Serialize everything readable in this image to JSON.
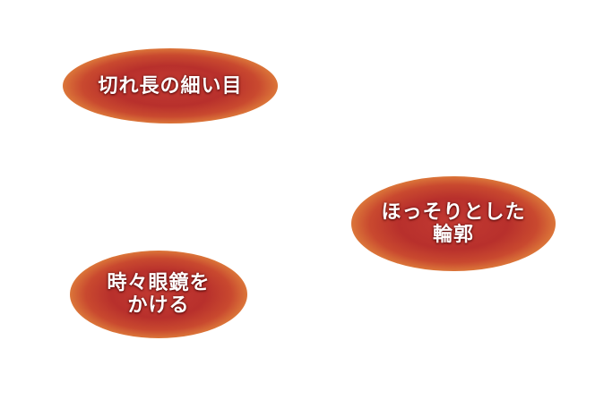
{
  "badges": [
    {
      "lines": [
        "切れ長の細い目"
      ]
    },
    {
      "lines": [
        "ほっそりとした",
        "輪郭"
      ]
    },
    {
      "lines": [
        "時々眼鏡を",
        "かける"
      ]
    }
  ]
}
